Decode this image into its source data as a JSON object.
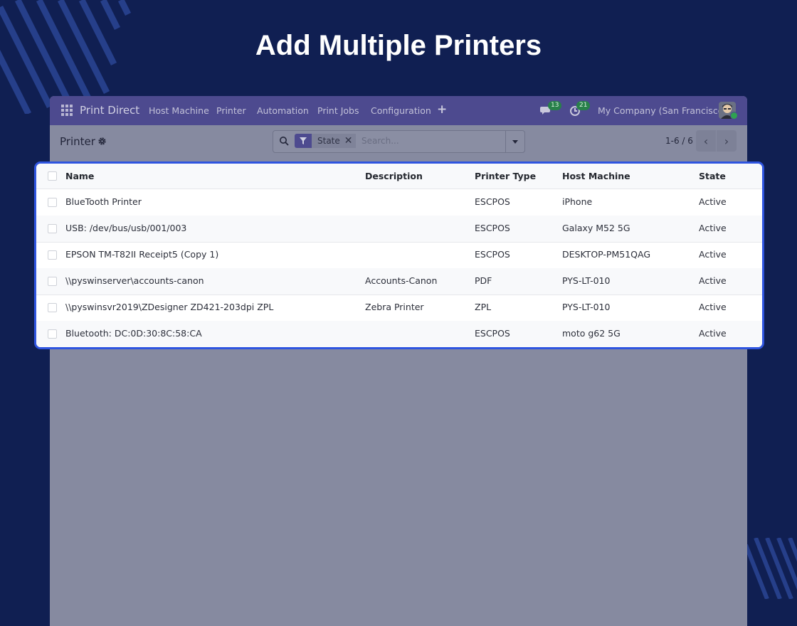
{
  "hero": {
    "title": "Add Multiple Printers"
  },
  "navbar": {
    "brand": "Print Direct",
    "menu": [
      "Host Machine",
      "Printer",
      "Automation",
      "Print Jobs",
      "Configuration"
    ],
    "plus": "+",
    "messages_count": "13",
    "activities_count": "21",
    "company": "My Company (San Francisco)"
  },
  "controlbar": {
    "breadcrumb": "Printer",
    "search": {
      "facet": "State",
      "placeholder": "Search..."
    },
    "pager": "1-6 / 6"
  },
  "table": {
    "columns": [
      "Name",
      "Description",
      "Printer Type",
      "Host Machine",
      "State"
    ],
    "rows": [
      {
        "name": "BlueTooth Printer",
        "description": "",
        "type": "ESCPOS",
        "host": "iPhone",
        "state": "Active"
      },
      {
        "name": "USB: /dev/bus/usb/001/003",
        "description": "",
        "type": "ESCPOS",
        "host": "Galaxy M52 5G",
        "state": "Active"
      },
      {
        "name": "EPSON TM-T82II Receipt5 (Copy 1)",
        "description": "",
        "type": "ESCPOS",
        "host": "DESKTOP-PM51QAG",
        "state": "Active"
      },
      {
        "name": "\\\\pyswinserver\\accounts-canon",
        "description": "Accounts-Canon",
        "type": "PDF",
        "host": "PYS-LT-010",
        "state": "Active"
      },
      {
        "name": "\\\\pyswinsvr2019\\ZDesigner ZD421-203dpi ZPL",
        "description": "Zebra Printer",
        "type": "ZPL",
        "host": "PYS-LT-010",
        "state": "Active"
      },
      {
        "name": "Bluetooth: DC:0D:30:8C:58:CA",
        "description": "",
        "type": "ESCPOS",
        "host": "moto g62 5G",
        "state": "Active"
      }
    ]
  },
  "colors": {
    "page_bg": "#101f52",
    "navbar_bg": "#4d4a8f",
    "highlight_border": "#2f55e0",
    "badge_green": "#28804a"
  }
}
